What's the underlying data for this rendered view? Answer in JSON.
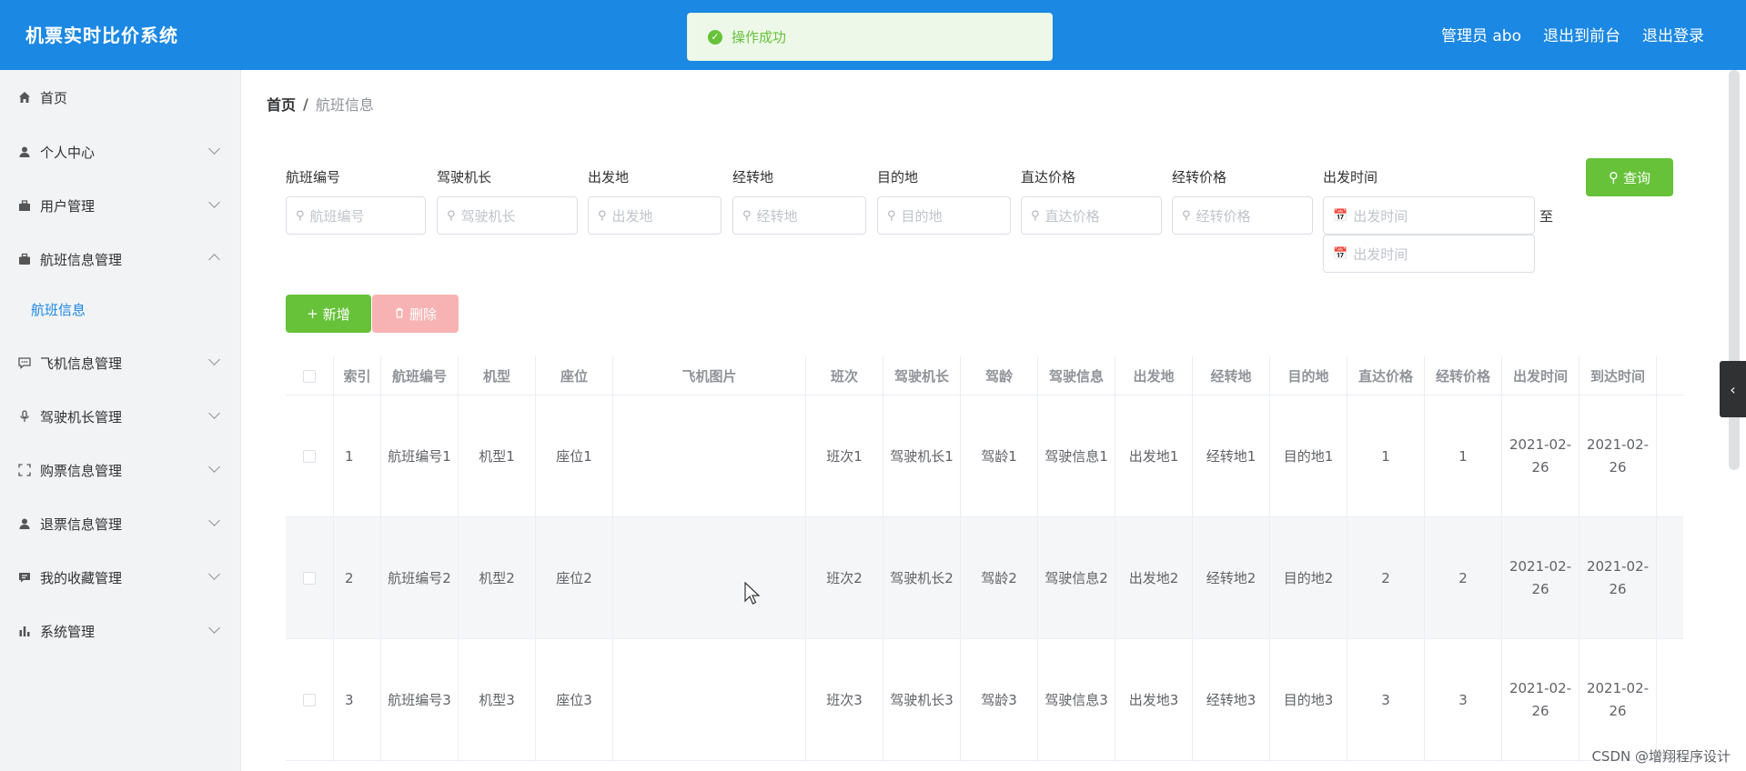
{
  "header": {
    "app_title": "机票实时比价系统",
    "links": [
      "管理员 abo",
      "退出到前台",
      "退出登录"
    ]
  },
  "toast": {
    "message": "操作成功",
    "color": "#67c23a"
  },
  "sidebar": {
    "items": [
      {
        "label": "首页",
        "icon": "home-icon"
      },
      {
        "label": "个人中心",
        "icon": "user-icon"
      },
      {
        "label": "用户管理",
        "icon": "suitcase-icon"
      },
      {
        "label": "航班信息管理",
        "icon": "briefcase-icon"
      },
      {
        "label": "飞机信息管理",
        "icon": "chat-icon"
      },
      {
        "label": "驾驶机长管理",
        "icon": "microphone-icon"
      },
      {
        "label": "购票信息管理",
        "icon": "fullscreen-icon"
      },
      {
        "label": "退票信息管理",
        "icon": "user-icon"
      },
      {
        "label": "我的收藏管理",
        "icon": "message-icon"
      },
      {
        "label": "系统管理",
        "icon": "bar-chart-icon"
      }
    ],
    "sub_item": "航班信息"
  },
  "breadcrumb": {
    "home": "首页",
    "separator": "/",
    "current": "航班信息"
  },
  "filters": [
    {
      "label": "航班编号",
      "placeholder": "航班编号"
    },
    {
      "label": "驾驶机长",
      "placeholder": "驾驶机长"
    },
    {
      "label": "出发地",
      "placeholder": "出发地"
    },
    {
      "label": "经转地",
      "placeholder": "经转地"
    },
    {
      "label": "目的地",
      "placeholder": "目的地"
    },
    {
      "label": "直达价格",
      "placeholder": "直达价格"
    },
    {
      "label": "经转价格",
      "placeholder": "经转价格"
    },
    {
      "label": "出发时间",
      "placeholder": "出发时间"
    }
  ],
  "date_end_placeholder": "出发时间",
  "date_separator": "至",
  "buttons": {
    "query": "查询",
    "add": "新增",
    "delete": "删除"
  },
  "table": {
    "columns": [
      "索引",
      "航班编号",
      "机型",
      "座位",
      "飞机图片",
      "班次",
      "驾驶机长",
      "驾龄",
      "驾驶信息",
      "出发地",
      "经转地",
      "目的地",
      "直达价格",
      "经转价格",
      "出发时间",
      "到达时间"
    ],
    "rows": [
      [
        "1",
        "航班编号1",
        "机型1",
        "座位1",
        "",
        "班次1",
        "驾驶机长1",
        "驾龄1",
        "驾驶信息1",
        "出发地1",
        "经转地1",
        "目的地1",
        "1",
        "1",
        "2021-02-26",
        "2021-02-26"
      ],
      [
        "2",
        "航班编号2",
        "机型2",
        "座位2",
        "",
        "班次2",
        "驾驶机长2",
        "驾龄2",
        "驾驶信息2",
        "出发地2",
        "经转地2",
        "目的地2",
        "2",
        "2",
        "2021-02-26",
        "2021-02-26"
      ],
      [
        "3",
        "航班编号3",
        "机型3",
        "座位3",
        "",
        "班次3",
        "驾驶机长3",
        "驾龄3",
        "驾驶信息3",
        "出发地3",
        "经转地3",
        "目的地3",
        "3",
        "3",
        "2021-02-26",
        "2021-02-26"
      ]
    ]
  },
  "watermark": "CSDN @增翔程序设计",
  "colors": {
    "header_bg": "#1b88e3",
    "success": "#67c23a",
    "danger_light": "#f7b3b3"
  }
}
